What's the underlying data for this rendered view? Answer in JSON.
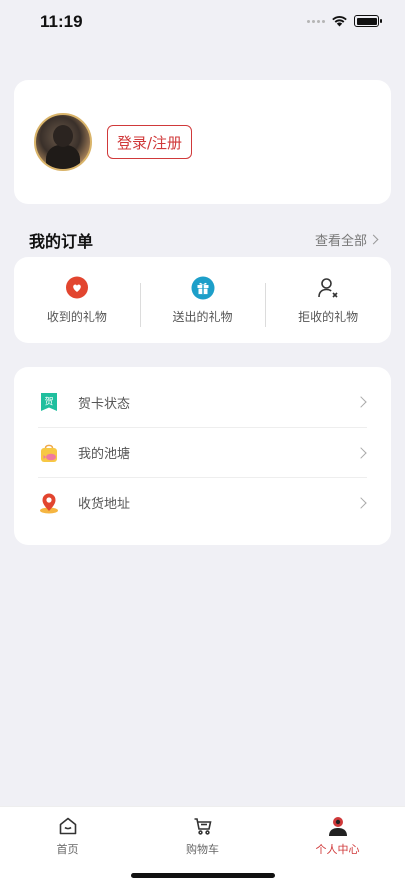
{
  "status_bar": {
    "time": "11:19"
  },
  "profile": {
    "login_label": "登录/注册"
  },
  "orders": {
    "title": "我的订单",
    "view_all": "查看全部",
    "items": [
      {
        "label": "收到的礼物",
        "icon": "heart-bubble-icon",
        "color": "#e2452f"
      },
      {
        "label": "送出的礼物",
        "icon": "gift-icon",
        "color": "#1d9fc9"
      },
      {
        "label": "拒收的礼物",
        "icon": "user-reject-icon",
        "color": "#333333"
      }
    ]
  },
  "menu": {
    "items": [
      {
        "label": "贺卡状态",
        "icon": "greeting-card-icon",
        "icon_text": "贺",
        "color": "#1fbf9e"
      },
      {
        "label": "我的池塘",
        "icon": "pond-bag-icon",
        "color": "#f5c046"
      },
      {
        "label": "收货地址",
        "icon": "location-pin-icon",
        "color": "#e2452f"
      }
    ]
  },
  "tabbar": {
    "tabs": [
      {
        "label": "首页",
        "icon": "home-icon"
      },
      {
        "label": "购物车",
        "icon": "cart-icon"
      },
      {
        "label": "个人中心",
        "icon": "profile-icon",
        "active": true
      }
    ],
    "active_color": "#d0393a"
  }
}
